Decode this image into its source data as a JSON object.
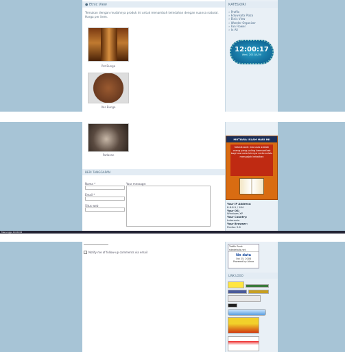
{
  "page_title": "Etnic View",
  "intro_text": "Temukan dengan mudahnya produk ini untuk menambah keindahan dengan nuansa natural. Harga per item.",
  "products": [
    {
      "caption": "Pot Bunga"
    },
    {
      "caption": "Vas Bunga"
    },
    {
      "caption": "Padasan"
    }
  ],
  "sidebar": {
    "category_title": "KATEGORI",
    "category_items": [
      "Profile",
      "Eduwisata Plaza",
      "Etnic View",
      "Wonder Organizer",
      "Fan Flower",
      "In All"
    ],
    "clock": {
      "time": "12:00:17",
      "date": "Wed, 2011/4/20"
    },
    "mutiara_title": "MUTIARA ISLAM HARI INI",
    "mutiara_text": "Sebaik-baik manusia adalah orang yang paling bermanfaat bagi manusia lainnya serta selalu mengajak kebaikan",
    "visitor": {
      "ip_label": "Your IP Address:",
      "ip_value": "8.8.8.5 / 184",
      "os_label": "Your OS:",
      "os_value": "Windows XP",
      "country_label": "Your Country:",
      "country_value": "Indonesia",
      "browser_label": "Your Browser:",
      "browser_value": "Firefox 3.6"
    },
    "traffic": {
      "title": "Traffic Rank",
      "site": "sitedetails.net",
      "nodata": "No data",
      "date": "Oct 25, 2008",
      "powered": "Powered by Alexa"
    },
    "links_title": "LINK LOGO"
  },
  "comment": {
    "title": "BERI TANGGAPAN",
    "name_label": "Nama *",
    "email_label": "Email *",
    "web_label": "Situs web",
    "message_label": "Your message:",
    "notify_label": "Notify me of follow-up comments via email"
  },
  "status_text": "Menunggu 10.00.04"
}
